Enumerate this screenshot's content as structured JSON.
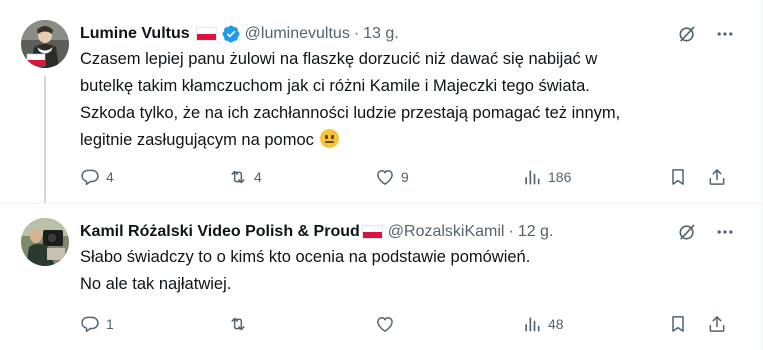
{
  "tweets": [
    {
      "display_name": "Lumine Vultus",
      "handle": "@luminevultus",
      "separator": "·",
      "time": "13 g.",
      "lines": [
        "Czasem lepiej panu żulowi na flaszkę dorzucić niż dawać się nabijać w",
        "butelkę takim kłamczuchom jak ci  różni Kamile i Majeczki tego świata.",
        "Szkoda tylko, że na ich zachłanności ludzie przestają pomagać też innym,",
        "legitnie zasługującym na pomoc"
      ],
      "stats": {
        "replies": "4",
        "reposts": "4",
        "likes": "9",
        "views": "186"
      }
    },
    {
      "display_name": "Kamil Różalski Video Polish & Proud",
      "handle": "@RozalskiKamil",
      "separator": "·",
      "time": "12 g.",
      "lines": [
        "Słabo świadczy to o kimś kto ocenia na podstawie pomówień.",
        "No ale tak najłatwiej."
      ],
      "stats": {
        "replies": "1",
        "reposts": "",
        "likes": "",
        "views": "48"
      }
    }
  ],
  "icons": {
    "verified": "verified-badge-icon",
    "grok": "grok-icon",
    "more": "more-icon",
    "reply": "reply-icon",
    "repost": "repost-icon",
    "like": "like-icon",
    "views": "views-icon",
    "bookmark": "bookmark-icon",
    "share": "share-icon"
  },
  "colors": {
    "text": "#0f1419",
    "secondary": "#536471",
    "verified": "#1d9bf0",
    "border": "#eff3f4",
    "thread_line": "#cfd9de"
  }
}
